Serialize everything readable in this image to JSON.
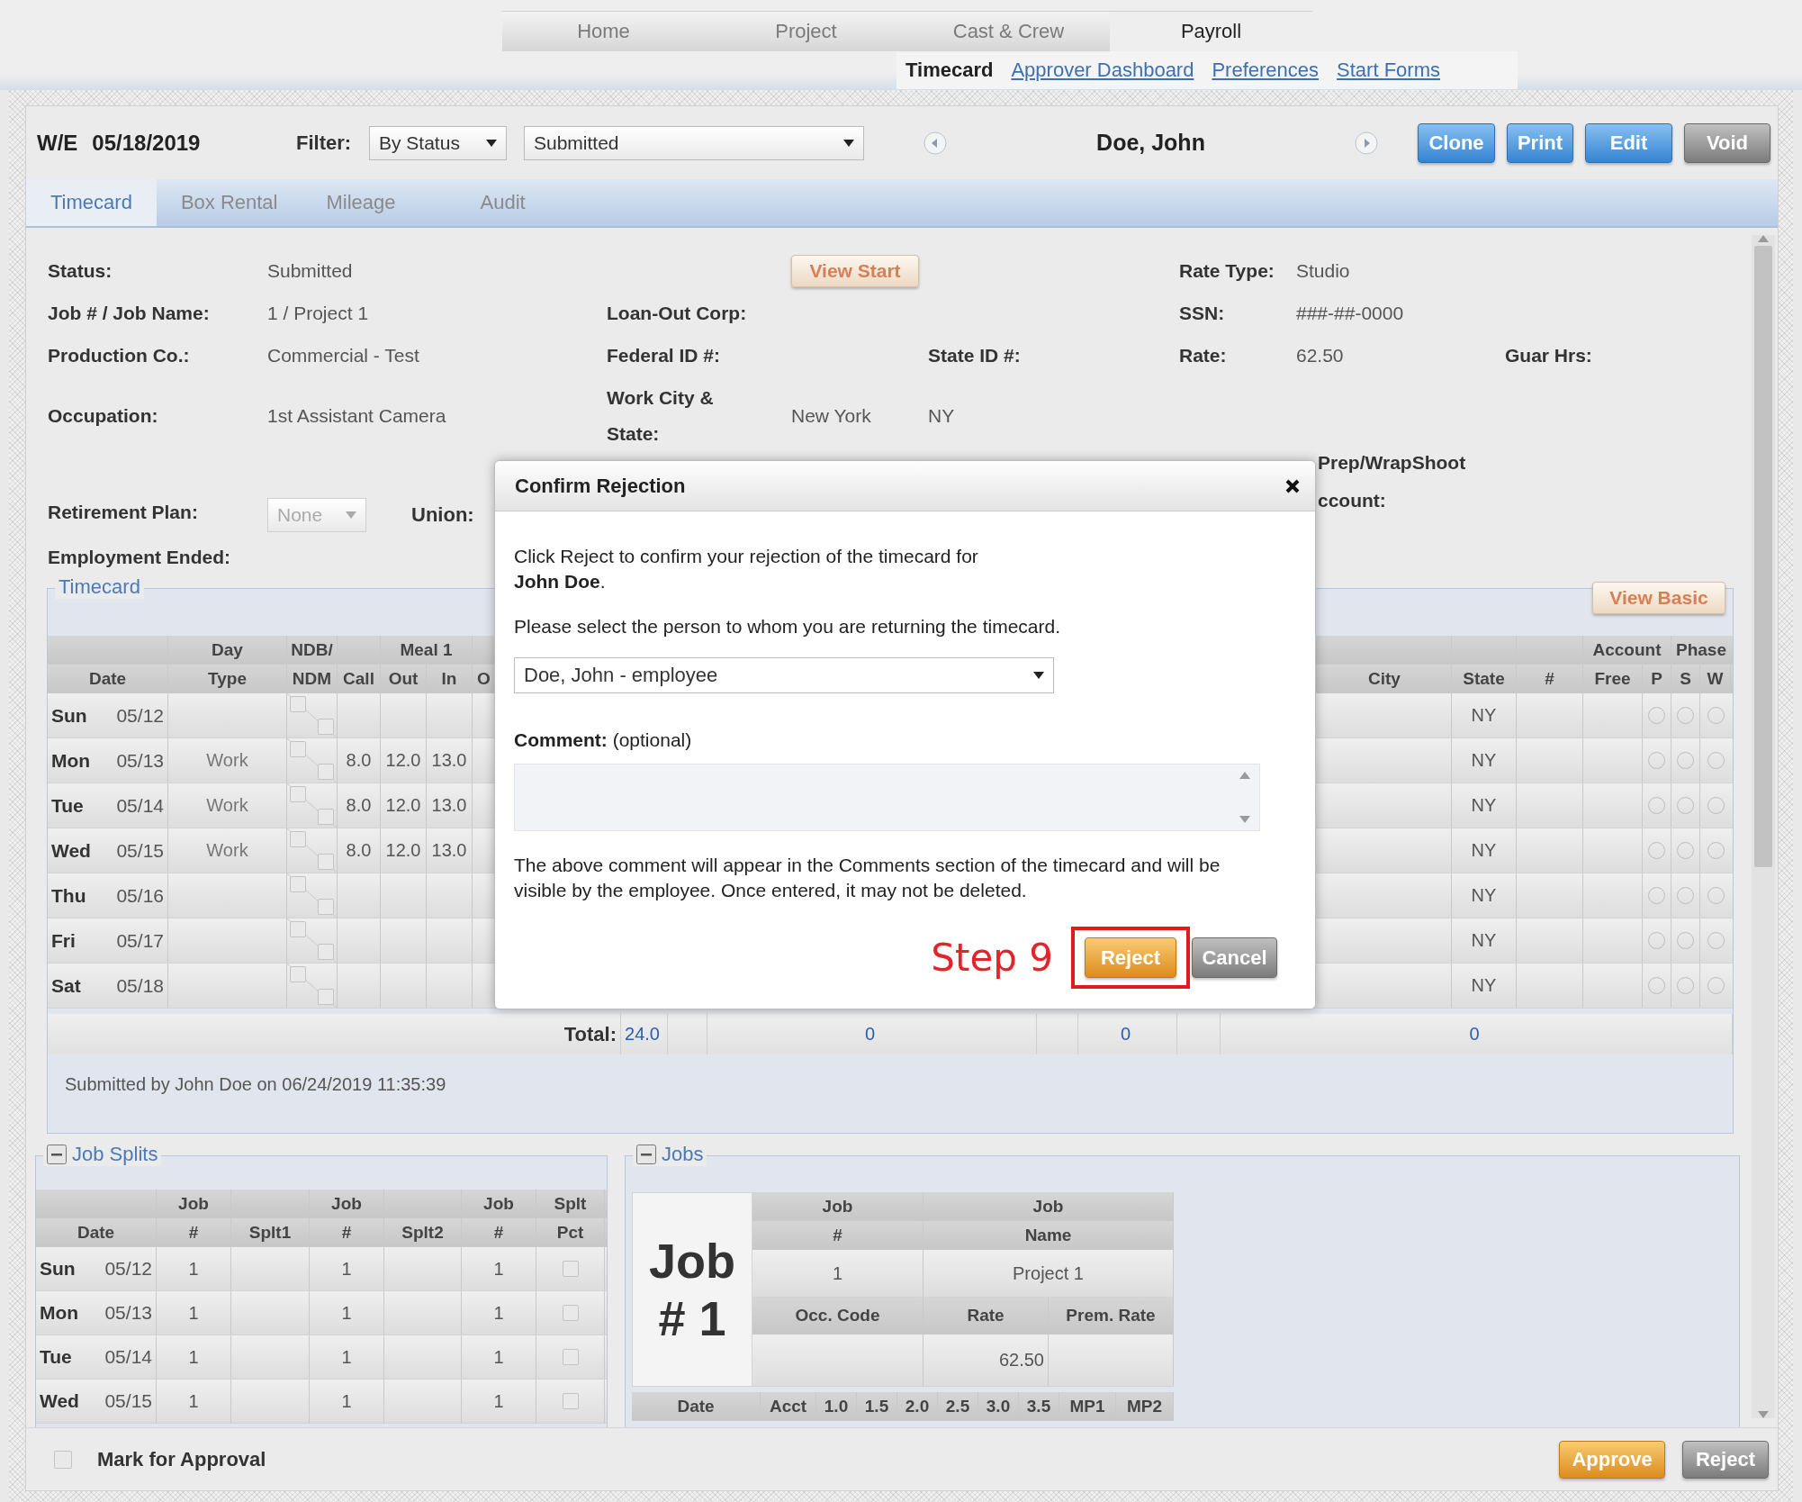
{
  "top_nav": {
    "tabs": [
      {
        "label": "Home",
        "selected": false
      },
      {
        "label": "Project",
        "selected": false
      },
      {
        "label": "Cast & Crew",
        "selected": false
      },
      {
        "label": "Payroll",
        "selected": true
      }
    ],
    "sub_links": [
      {
        "label": "Timecard",
        "selected": true
      },
      {
        "label": "Approver Dashboard",
        "selected": false
      },
      {
        "label": "Preferences",
        "selected": false
      },
      {
        "label": "Start Forms",
        "selected": false
      }
    ]
  },
  "toolbar": {
    "week_label": "W/E",
    "week_date": "05/18/2019",
    "filter_label": "Filter:",
    "filter_type": "By Status",
    "filter_value": "Submitted",
    "employee": "Doe, John",
    "buttons": [
      {
        "label": "Clone",
        "kind": "primary"
      },
      {
        "label": "Print",
        "kind": "primary"
      },
      {
        "label": "Edit",
        "kind": "primary"
      },
      {
        "label": "Void",
        "kind": "neutral"
      }
    ]
  },
  "tabs": [
    {
      "label": "Timecard",
      "selected": true
    },
    {
      "label": "Box Rental",
      "selected": false
    },
    {
      "label": "Mileage",
      "selected": false
    },
    {
      "label": "Audit",
      "selected": false
    }
  ],
  "details": {
    "status": {
      "label": "Status:",
      "value": "Submitted"
    },
    "view_start": "View Start",
    "rate_type": {
      "label": "Rate Type:",
      "value": "Studio"
    },
    "job": {
      "label": "Job # / Job Name:",
      "value": "1 / Project 1"
    },
    "loan_out_corp": {
      "label": "Loan-Out Corp:"
    },
    "ssn": {
      "label": "SSN:",
      "value": "###-##-0000"
    },
    "production_co": {
      "label": "Production Co.:",
      "value": "Commercial - Test"
    },
    "federal_id": {
      "label": "Federal ID #:"
    },
    "state_id": {
      "label": "State ID #:"
    },
    "rate": {
      "label": "Rate:",
      "value": "62.50"
    },
    "guar_hrs": {
      "label": "Guar Hrs:"
    },
    "occupation": {
      "label": "Occupation:",
      "value": "1st Assistant Camera"
    },
    "work_city_state": {
      "label": "Work City & State:",
      "city": "New York",
      "state": "NY"
    },
    "retirement_plan": {
      "label": "Retirement Plan:",
      "value": "None",
      "disabled": true
    },
    "union": {
      "label": "Union:"
    },
    "prep_wrap_account": {
      "line_1": "Prep/WrapShoot",
      "line_2": "ccount:"
    },
    "employment_ended": {
      "label": "Employment Ended:"
    }
  },
  "timecard": {
    "legend": "Timecard",
    "view_basic": "View Basic",
    "header_top": {
      "type": "Day",
      "ndb": "NDB/",
      "meal": "Meal 1",
      "account": "Account",
      "phase": "Phase"
    },
    "header": {
      "date": "Date",
      "type": "Type",
      "ndm": "NDM",
      "call": "Call",
      "out": "Out",
      "in": "In",
      "col_o": "O",
      "city": "City",
      "state": "State",
      "num": "#",
      "free": "Free",
      "p": "P",
      "s": "S",
      "w": "W"
    },
    "rows": [
      {
        "day": "Sun",
        "date": "05/12",
        "state": "NY",
        "ndb": false,
        "ndm": false,
        "phase_p": false,
        "phase_s": false,
        "phase_w": false
      },
      {
        "day": "Mon",
        "date": "05/13",
        "type": "Work",
        "call": "8.0",
        "out": "12.0",
        "in": "13.0",
        "state": "NY",
        "ndb": false,
        "ndm": false,
        "phase_p": false,
        "phase_s": false,
        "phase_w": false
      },
      {
        "day": "Tue",
        "date": "05/14",
        "type": "Work",
        "call": "8.0",
        "out": "12.0",
        "in": "13.0",
        "state": "NY",
        "ndb": false,
        "ndm": false,
        "phase_p": false,
        "phase_s": false,
        "phase_w": false
      },
      {
        "day": "Wed",
        "date": "05/15",
        "type": "Work",
        "call": "8.0",
        "out": "12.0",
        "in": "13.0",
        "state": "NY",
        "ndb": false,
        "ndm": false,
        "phase_p": false,
        "phase_s": false,
        "phase_w": false
      },
      {
        "day": "Thu",
        "date": "05/16",
        "state": "NY",
        "ndb": false,
        "ndm": false,
        "phase_p": false,
        "phase_s": false,
        "phase_w": false
      },
      {
        "day": "Fri",
        "date": "05/17",
        "state": "NY",
        "ndb": false,
        "ndm": false,
        "phase_p": false,
        "phase_s": false,
        "phase_w": false
      },
      {
        "day": "Sat",
        "date": "05/18",
        "state": "NY",
        "ndb": false,
        "ndm": false,
        "phase_p": false,
        "phase_s": false,
        "phase_w": false
      }
    ],
    "total": {
      "label": "Total:",
      "values": [
        "24.0",
        "0",
        "0",
        "0"
      ]
    },
    "submitted_by": "Submitted by John Doe on 06/24/2019 11:35:39"
  },
  "job_splits": {
    "legend": "Job Splits",
    "expanded": true,
    "header_top": [
      "Job",
      "Job",
      "Job",
      "Splt"
    ],
    "header": [
      "Date",
      "#",
      "Splt1",
      "#",
      "Splt2",
      "#",
      "Pct"
    ],
    "rows": [
      {
        "day": "Sun",
        "date": "05/12",
        "job_1": "1",
        "job_2": "1",
        "job_3": "1",
        "pct_checked": false
      },
      {
        "day": "Mon",
        "date": "05/13",
        "job_1": "1",
        "job_2": "1",
        "job_3": "1",
        "pct_checked": false
      },
      {
        "day": "Tue",
        "date": "05/14",
        "job_1": "1",
        "job_2": "1",
        "job_3": "1",
        "pct_checked": false
      },
      {
        "day": "Wed",
        "date": "05/15",
        "job_1": "1",
        "job_2": "1",
        "job_3": "1",
        "pct_checked": false
      }
    ]
  },
  "jobs": {
    "legend": "Jobs",
    "expanded": true,
    "card_line_1": "Job",
    "card_line_2": "# 1",
    "info_header_top": [
      "Job",
      "Job"
    ],
    "info_header_bottom": [
      "#",
      "Name"
    ],
    "info_values": [
      "1",
      "Project 1"
    ],
    "rate_header": [
      "Occ. Code",
      "Rate",
      "Prem. Rate"
    ],
    "rate": "62.50",
    "hours_header": [
      "Date",
      "Acct",
      "1.0",
      "1.5",
      "2.0",
      "2.5",
      "3.0",
      "3.5",
      "MP1",
      "MP2"
    ]
  },
  "footer": {
    "mark_label": "Mark for Approval",
    "mark_checked": false,
    "buttons": [
      {
        "label": "Approve",
        "kind": "accent"
      },
      {
        "label": "Reject",
        "kind": "neutral"
      }
    ]
  },
  "dialog": {
    "title": "Confirm Rejection",
    "message": "Click Reject to confirm your rejection of the timecard for\n**John Doe**.",
    "prompt": "Please select the person to whom you are returning the timecard.",
    "recipient": "Doe, John - employee",
    "comment_label": "**Comment:** (optional)",
    "note": "The above comment will appear in the Comments section of the timecard and will be visible by the employee. Once entered, it may not be deleted.",
    "buttons": [
      {
        "label": "Reject",
        "kind": "accent",
        "highlighted": true
      },
      {
        "label": "Cancel",
        "kind": "neutral",
        "highlighted": false
      }
    ]
  },
  "annotation": {
    "label": "Step 9"
  }
}
